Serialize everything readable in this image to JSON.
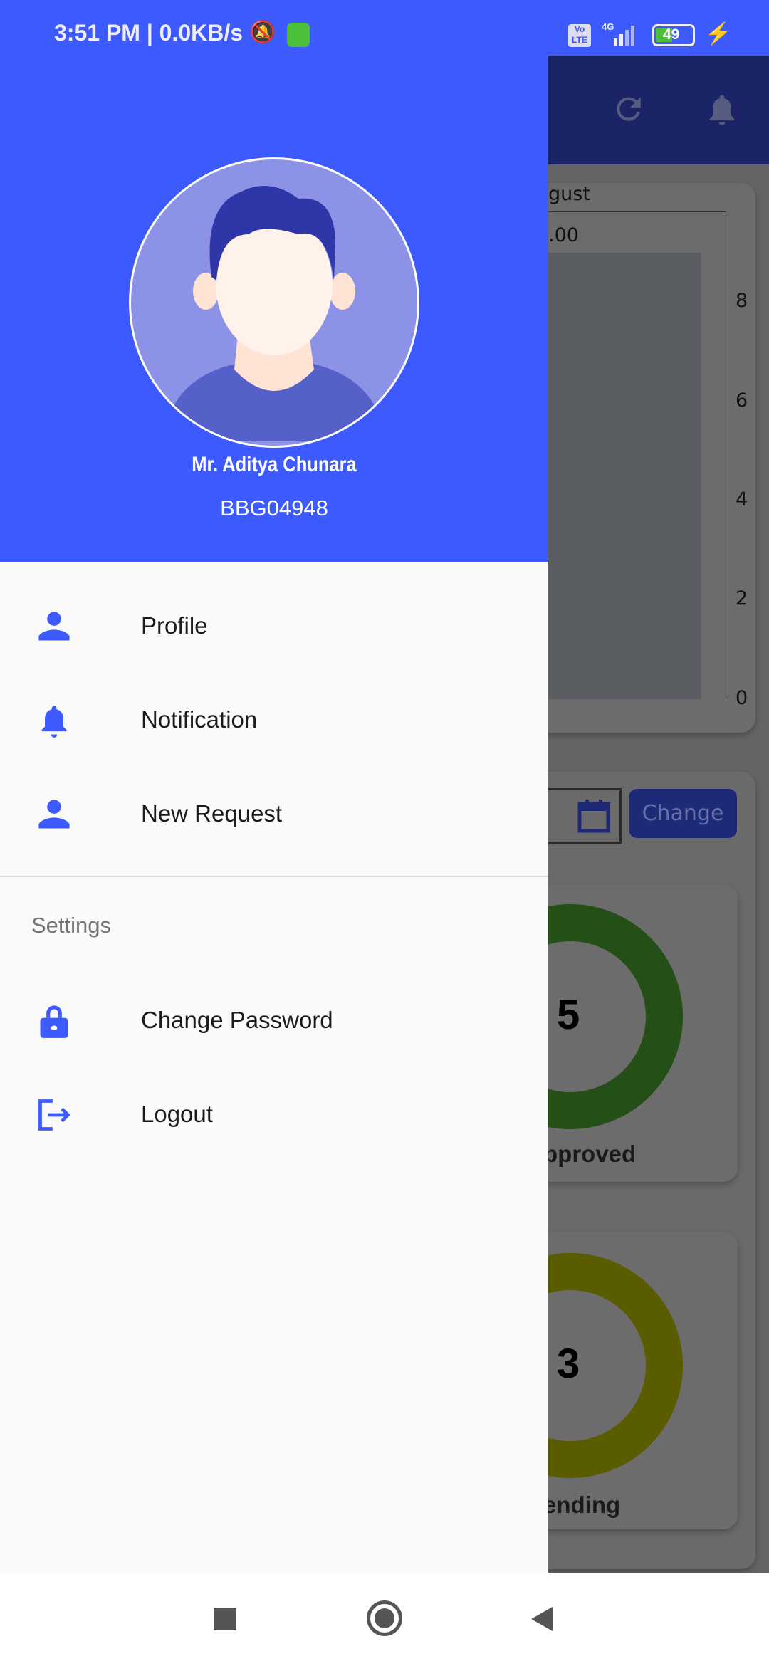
{
  "status_bar": {
    "time": "3:51 PM",
    "net_speed": "0.0KB/s",
    "network": "4G",
    "volte": "Vo LTE",
    "battery": "49",
    "icons": [
      "mute-bell-icon",
      "app-icon",
      "signal-icon",
      "battery-icon",
      "charging-icon"
    ]
  },
  "drawer": {
    "user_name": "Mr. Aditya Chunara",
    "user_id": "BBG04948",
    "items": [
      {
        "label": "Profile",
        "icon": "person-icon"
      },
      {
        "label": "Notification",
        "icon": "bell-icon"
      },
      {
        "label": "New Request",
        "icon": "person-icon"
      }
    ],
    "section_title": "Settings",
    "settings_items": [
      {
        "label": "Change Password",
        "icon": "lock-icon"
      },
      {
        "label": "Logout",
        "icon": "logout-icon"
      }
    ]
  },
  "background": {
    "chart_title_fragment": "gust",
    "chart_value_fragment": ".00",
    "y_ticks": [
      "8",
      "6",
      "4",
      "2",
      "0"
    ],
    "change_button": "Change",
    "approved": {
      "count": "5",
      "label_fragment": "pproved"
    },
    "pending": {
      "count": "3",
      "label_fragment": "ending"
    }
  },
  "colors": {
    "primary": "#3d5afe",
    "approved": "#244f16",
    "pending": "#5b5b00"
  }
}
